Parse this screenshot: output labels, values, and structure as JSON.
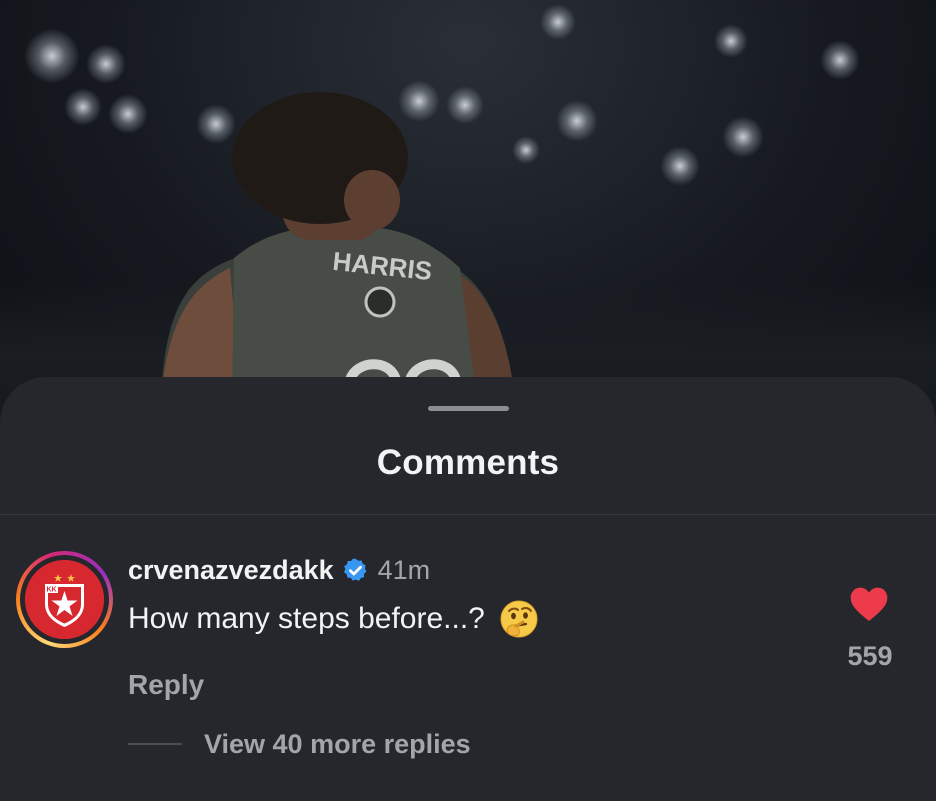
{
  "background": {
    "description_icon": "arena-photo-background",
    "jersey_name": "HARRIS"
  },
  "sheet": {
    "title": "Comments"
  },
  "comment": {
    "username": "crvenazvezdakk",
    "verified_icon": "verified-badge-icon",
    "time": "41m",
    "text": "How many steps before...?",
    "emoji_icon": "thinking-face-emoji",
    "reply_label": "Reply",
    "like_icon": "heart-icon",
    "like_count": "559",
    "avatar_badge_text": "KK"
  },
  "replies": {
    "view_more_label": "View 40 more replies"
  },
  "colors": {
    "sheet_bg": "#25272c",
    "primary_text": "#f2f3f5",
    "secondary_text": "#a2a5ab",
    "heart_red": "#ed3b4b",
    "verified_blue": "#3897f0",
    "avatar_red": "#d7282f"
  }
}
